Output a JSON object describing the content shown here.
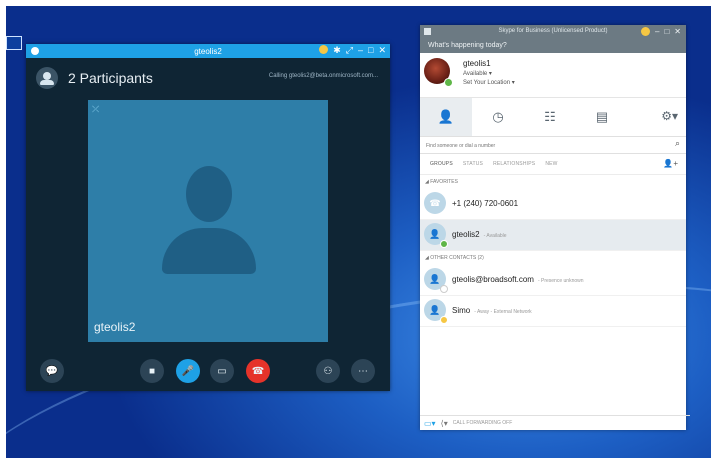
{
  "call_window": {
    "title": "gteolis2",
    "participants": "2 Participants",
    "calling_status": "Calling gteolis2@beta.onmicrosoft.com...",
    "video_name": "gteolis2",
    "controls": [
      "im",
      "video",
      "mic",
      "share",
      "hang-up",
      "participants",
      "more"
    ]
  },
  "sfb": {
    "app_title": "Skype for Business (Unlicensed Product)",
    "whats_happening": "What's happening today?",
    "me": {
      "name": "gteolis1",
      "availability": "Available ▾",
      "location": "Set Your Location ▾"
    },
    "search_placeholder": "Find someone or dial a number",
    "subtabs": [
      "GROUPS",
      "STATUS",
      "RELATIONSHIPS",
      "NEW"
    ],
    "groups": {
      "favorites": "◢ FAVORITES",
      "other": "◢ OTHER CONTACTS (2)"
    },
    "contacts": [
      {
        "name": "+1 (240) 720-0601",
        "note": ""
      },
      {
        "name": "gteolis2",
        "note": "- Available"
      },
      {
        "name": "gteolis@broadsoft.com",
        "note": "- Presence unknown"
      },
      {
        "name": "Simo",
        "note": "- Away - External Network"
      }
    ],
    "footer": "CALL FORWARDING OFF"
  },
  "colors": {
    "accent": "#1ea1e6",
    "available": "#5fb648",
    "away": "#f6c744",
    "end_call": "#e5332a"
  }
}
